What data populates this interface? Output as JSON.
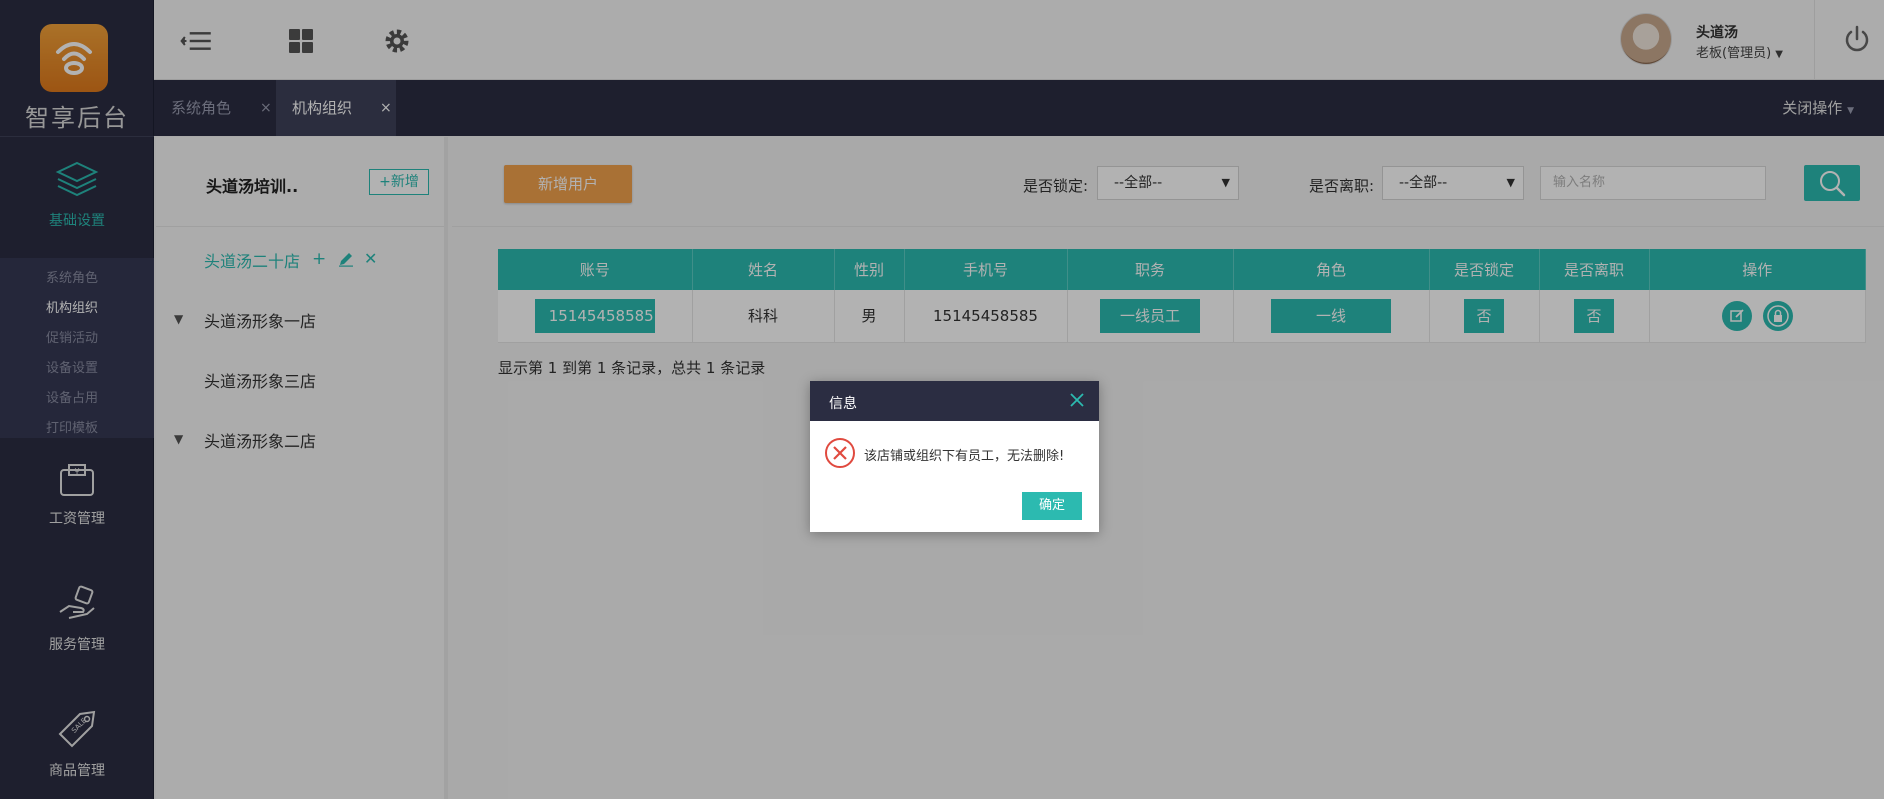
{
  "sidebar": {
    "logo_text": "智享后台",
    "nav": [
      {
        "label": "基础设置",
        "icon": "layers-icon",
        "active": true
      },
      {
        "label": "工资管理",
        "icon": "wallet-icon"
      },
      {
        "label": "服务管理",
        "icon": "service-hand-icon"
      },
      {
        "label": "商品管理",
        "icon": "sale-tag-icon"
      }
    ],
    "submenu": [
      "系统角色",
      "机构组织",
      "促销活动",
      "设备设置",
      "设备占用",
      "打印模板"
    ]
  },
  "header": {
    "user_name": "头道汤",
    "user_role": "老板(管理员)"
  },
  "tabs": {
    "items": [
      {
        "label": "系统角色",
        "close": "×"
      },
      {
        "label": "机构组织",
        "close": "×"
      }
    ],
    "close_ops": "关闭操作"
  },
  "tree": {
    "title": "头道汤培训..",
    "add_label": "+新增",
    "items": [
      "头道汤二十店",
      "头道汤形象一店",
      "头道汤形象三店",
      "头道汤形象二店"
    ]
  },
  "filters": {
    "new_user": "新增用户",
    "locked_label": "是否锁定:",
    "locked_value": "--全部--",
    "resigned_label": "是否离职:",
    "resigned_value": "--全部--",
    "name_placeholder": "输入名称"
  },
  "table": {
    "headers": [
      "账号",
      "姓名",
      "性别",
      "手机号",
      "职务",
      "角色",
      "是否锁定",
      "是否离职",
      "操作"
    ],
    "rows": [
      {
        "account": "15145458585",
        "name": "科科",
        "gender": "男",
        "phone": "15145458585",
        "job": "一线员工",
        "role": "一线",
        "locked": "否",
        "resigned": "否"
      }
    ],
    "records": "显示第 1 到第 1 条记录，总共 1 条记录"
  },
  "dialog": {
    "title": "信息",
    "message": "该店铺或组织下有员工，无法删除!",
    "ok": "确定"
  },
  "colors": {
    "accent": "#2cbab0",
    "dark": "#2b2d42",
    "orange": "#f3a24d",
    "error": "#e04a3f"
  }
}
